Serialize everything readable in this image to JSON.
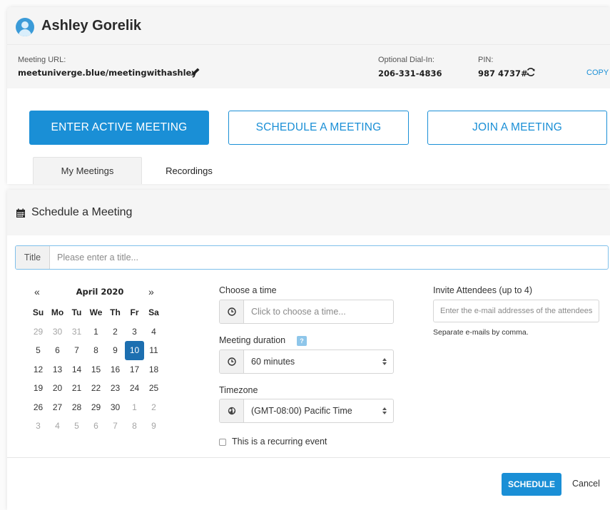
{
  "user": {
    "name": "Ashley Gorelik"
  },
  "meeting_info": {
    "url_label": "Meeting URL:",
    "url_value": "meetuniverge.blue/meetingwithashley",
    "dialin_label": "Optional Dial-In:",
    "dialin_value": "206-331-4836",
    "pin_label": "PIN:",
    "pin_value": "987 4737#",
    "copy_label": "COPY"
  },
  "actions": {
    "enter_label": "ENTER ACTIVE MEETING",
    "schedule_label": "SCHEDULE A MEETING",
    "join_label": "JOIN A MEETING"
  },
  "tabs": [
    {
      "label": "My Meetings",
      "active": true
    },
    {
      "label": "Recordings",
      "active": false
    }
  ],
  "schedule": {
    "heading": "Schedule a Meeting",
    "title_addon": "Title",
    "title_placeholder": "Please enter a title...",
    "calendar": {
      "prev": "«",
      "next": "»",
      "month": "April 2020",
      "weekdays": [
        "Su",
        "Mo",
        "Tu",
        "We",
        "Th",
        "Fr",
        "Sa"
      ],
      "weeks": [
        [
          "29",
          "30",
          "31",
          "1",
          "2",
          "3",
          "4"
        ],
        [
          "5",
          "6",
          "7",
          "8",
          "9",
          "10",
          "11"
        ],
        [
          "12",
          "13",
          "14",
          "15",
          "16",
          "17",
          "18"
        ],
        [
          "19",
          "20",
          "21",
          "22",
          "23",
          "24",
          "25"
        ],
        [
          "26",
          "27",
          "28",
          "29",
          "30",
          "1",
          "2"
        ],
        [
          "3",
          "4",
          "5",
          "6",
          "7",
          "8",
          "9"
        ]
      ],
      "selected": "10"
    },
    "time_label": "Choose a time",
    "time_placeholder": "Click to choose a time...",
    "duration_label": "Meeting duration",
    "duration_value": "60 minutes",
    "info_badge": "?",
    "timezone_label": "Timezone",
    "timezone_value": "(GMT-08:00) Pacific Time",
    "recurring_label": "This is a recurring event",
    "invite_label": "Invite Attendees (up to 4)",
    "invite_placeholder": "Enter the e-mail addresses of the attendees",
    "invite_hint": "Separate e-mails by comma.",
    "schedule_button": "SCHEDULE",
    "cancel_label": "Cancel"
  },
  "icons": {
    "avatar": "user-avatar-icon",
    "edit": "pencil-icon",
    "refresh": "refresh-icon",
    "calendar": "calendar-icon",
    "clock": "clock-icon",
    "globe": "globe-icon",
    "select": "select-arrows-icon"
  },
  "colors": {
    "accent": "#1a8fd6",
    "selected_day": "#1d6fb0",
    "input_focus": "#7fc0ea"
  }
}
